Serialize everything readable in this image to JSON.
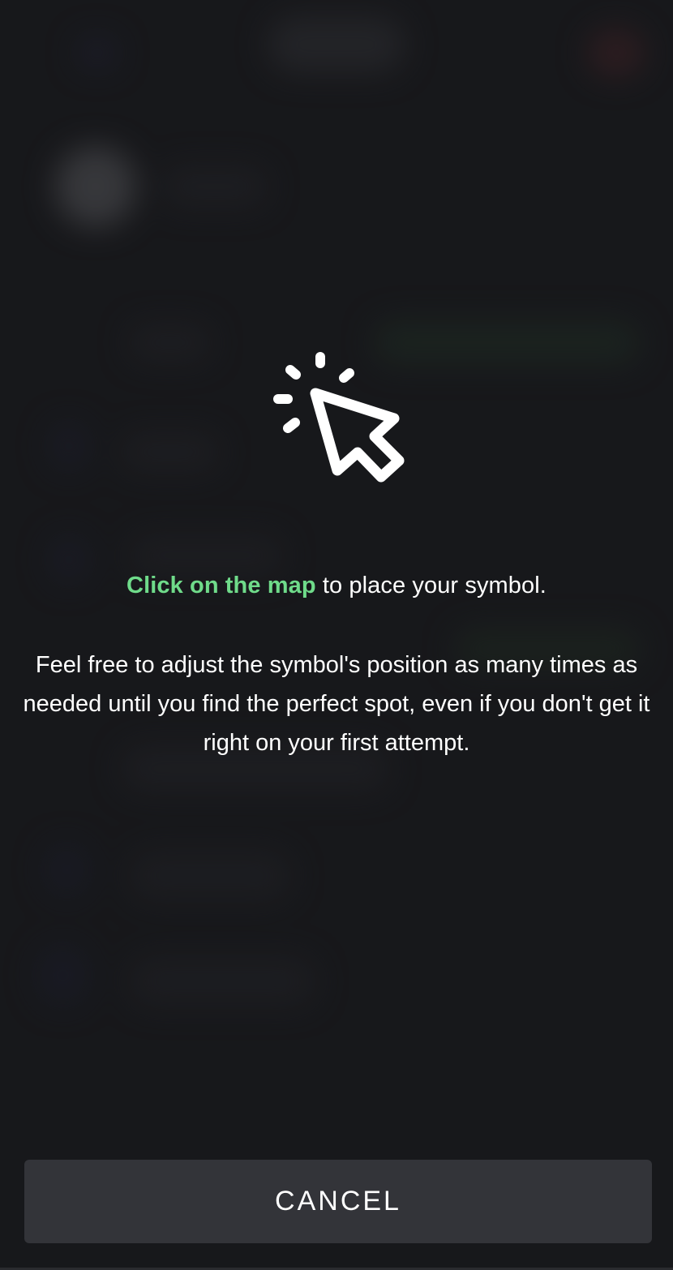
{
  "instruction": {
    "highlight": "Click on the map",
    "rest": " to place your symbol."
  },
  "hint": {
    "text": "Feel free to adjust the symbol's position as many times as needed until you find the perfect spot, even if you don't get it right on your first attempt."
  },
  "actions": {
    "cancel_label": "CANCEL"
  },
  "icons": {
    "main": "click-pointer-icon"
  },
  "colors": {
    "accent": "#6fdb8a",
    "background": "#1a1b1e",
    "button": "#333439"
  }
}
